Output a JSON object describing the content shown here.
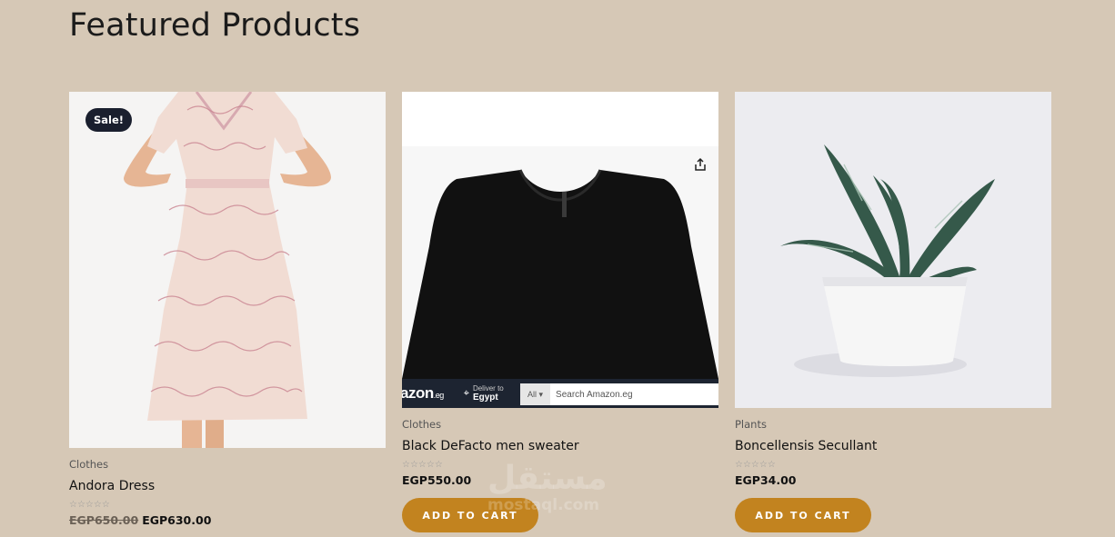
{
  "section": {
    "title": "Featured Products"
  },
  "colors": {
    "background": "#d6c8b6",
    "button": "#c2831f",
    "badge": "#1a1f2e"
  },
  "products": [
    {
      "category": "Clothes",
      "title": "Andora Dress",
      "badge": "Sale!",
      "rating_stars": "☆☆☆☆☆",
      "old_price": "EGP650.00",
      "price": "EGP630.00",
      "image_icon": "dress-image"
    },
    {
      "category": "Clothes",
      "title": "Black DeFacto men sweater",
      "rating_stars": "☆☆☆☆☆",
      "price": "EGP550.00",
      "button": "ADD TO CART",
      "image_icon": "sweater-image",
      "amazon": {
        "logo": "azon",
        "logo_suffix": ".eg",
        "deliver_line1": "Deliver to",
        "deliver_line2": "Egypt",
        "all_label": "All ▾",
        "search_placeholder": "Search Amazon.eg"
      }
    },
    {
      "category": "Plants",
      "title": "Boncellensis Secullant",
      "rating_stars": "☆☆☆☆☆",
      "price": "EGP34.00",
      "button": "ADD TO CART",
      "image_icon": "plant-image"
    }
  ],
  "watermark": {
    "arabic": "مستقل",
    "latin": "mostaql.com"
  }
}
